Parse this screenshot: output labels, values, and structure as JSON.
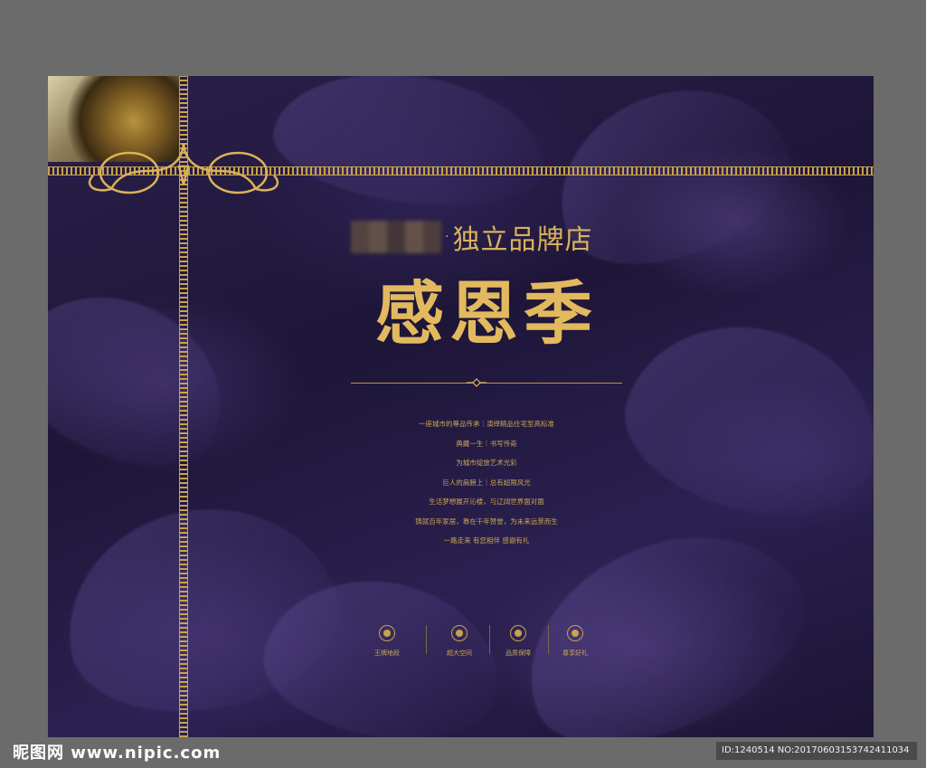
{
  "poster": {
    "brand_suffix": "·",
    "brand_text": "独立品牌店",
    "title": "感恩季",
    "copy_lines": [
      "一座城市的尊品传承｜演绎精品住宅至高标准",
      "典藏一生｜书写传奇",
      "为城市绽放艺术光彩",
      "巨人的肩膀上｜总有超限风光",
      "生活梦想展开沁楼，与辽阔世界面对面",
      "铸就百年家居，靠在千年赞誉，为未来远景而生",
      "一路走来 有您相伴 感谢有礼"
    ],
    "features": [
      {
        "icon": "emblem-icon",
        "label": "王牌地段"
      },
      {
        "icon": "emblem-icon",
        "label": "超大空间"
      },
      {
        "icon": "emblem-icon",
        "label": "品质保障"
      },
      {
        "icon": "emblem-icon",
        "label": "尊享好礼"
      }
    ],
    "colors": {
      "gold": "#d9b25a",
      "background": "#231a42"
    }
  },
  "watermark": {
    "site_cn": "昵图网",
    "site_url": "www.nipic.com",
    "id_text": "ID:1240514 NO:20170603153742411034"
  }
}
